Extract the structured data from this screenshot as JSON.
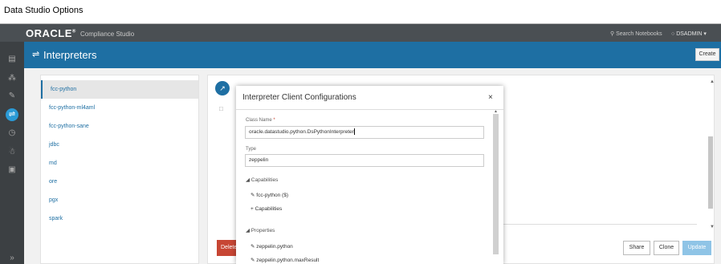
{
  "window": {
    "title": "Data Studio Options"
  },
  "topbar": {
    "logo": "ORACLE",
    "logo_trademark": "®",
    "product": "Compliance Studio",
    "search_icon": "search-icon",
    "search_label": "Search Notebooks",
    "user_icon": "user-icon",
    "user_label": "DSADMIN",
    "user_caret": "▾"
  },
  "header": {
    "icon": "interpreters-icon",
    "title": "Interpreters",
    "create_label": "Create"
  },
  "nav": {
    "icons": [
      "home-icon",
      "workspace-icon",
      "pen-icon",
      "interpreters-icon",
      "clock-icon",
      "users-icon",
      "lock-icon"
    ],
    "expand": "»"
  },
  "interpreters": [
    {
      "name": "fcc-python",
      "selected": true
    },
    {
      "name": "fcc-python-ml4aml",
      "selected": false
    },
    {
      "name": "fcc-python-sane",
      "selected": false
    },
    {
      "name": "jdbc",
      "selected": false
    },
    {
      "name": "md",
      "selected": false
    },
    {
      "name": "ore",
      "selected": false
    },
    {
      "name": "pgx",
      "selected": false
    },
    {
      "name": "spark",
      "selected": false
    }
  ],
  "actions": {
    "delete_label": "Delete",
    "share_label": "Share",
    "clone_label": "Clone",
    "update_label": "Update"
  },
  "modal": {
    "title": "Interpreter Client Configurations",
    "close": "×",
    "class_name_label": "Class Name",
    "required_mark": "*",
    "class_name_value": "oracle.datastudio.python.DsPythonInterpreter",
    "type_label": "Type",
    "type_value": "zeppelin",
    "capabilities_header": "◢ Capabilities",
    "capabilities": [
      "fcc-python ($)"
    ],
    "add_capabilities": "+ Capabilities",
    "properties_header": "◢ Properties",
    "properties": [
      "zeppelin.python",
      "zeppelin.python.maxResult"
    ]
  },
  "colors": {
    "brand_blue": "#1e6fa3",
    "delete_red": "#c74634",
    "topbar": "#4a4f53",
    "nav": "#3c4043"
  }
}
